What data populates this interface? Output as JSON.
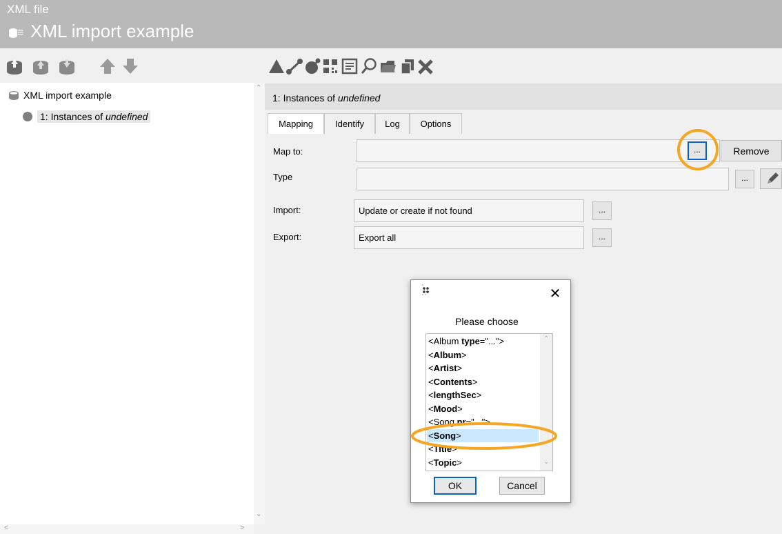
{
  "header": {
    "subtitle": "XML file",
    "title": "XML import example"
  },
  "toolbar_left": [
    "import-db-icon",
    "upload-db-icon",
    "download-db-icon",
    "move-up-icon",
    "move-down-icon"
  ],
  "toolbar_right": [
    "triangle-icon",
    "link-icon",
    "node-icon",
    "qr-icon",
    "document-icon",
    "search-icon",
    "folder-icon",
    "copy-icon",
    "delete-icon"
  ],
  "tree": {
    "root_label": "XML import example",
    "child_prefix": "1: Instances of ",
    "child_italic": "undefined"
  },
  "panel": {
    "title_prefix": "1: Instances of ",
    "title_italic": "undefined",
    "tabs": [
      "Mapping",
      "Identify",
      "Log",
      "Options"
    ],
    "map_to_label": "Map to:",
    "map_to_value": "",
    "remove_label": "Remove",
    "type_label": "Type",
    "type_value": "",
    "import_label": "Import:",
    "import_value": "Update or create if not found",
    "export_label": "Export:",
    "export_value": "Export all",
    "dots_label": "..."
  },
  "dialog": {
    "prompt": "Please choose",
    "close_label": "✕",
    "items": [
      {
        "pre": "<Album ",
        "bold": "type",
        "post": "=\"...\">"
      },
      {
        "pre": "<",
        "bold": "Album",
        "post": ">"
      },
      {
        "pre": "<",
        "bold": "Artist",
        "post": ">"
      },
      {
        "pre": "<",
        "bold": "Contents",
        "post": ">"
      },
      {
        "pre": "<",
        "bold": "lengthSec",
        "post": ">"
      },
      {
        "pre": "<",
        "bold": "Mood",
        "post": ">"
      },
      {
        "pre": "<Song ",
        "bold": "nr",
        "post": "=\"...\">"
      },
      {
        "pre": "<",
        "bold": "Song",
        "post": ">"
      },
      {
        "pre": "<",
        "bold": "Title",
        "post": ">"
      },
      {
        "pre": "<",
        "bold": "Topic",
        "post": ">"
      }
    ],
    "selected_index": 7,
    "ok_label": "OK",
    "cancel_label": "Cancel"
  },
  "colors": {
    "header_bg": "#b9b9b9",
    "highlight": "#f5a623",
    "selection": "#cce8ff",
    "icon_gray": "#5a5a5a",
    "ok_border": "#0a64c8"
  }
}
